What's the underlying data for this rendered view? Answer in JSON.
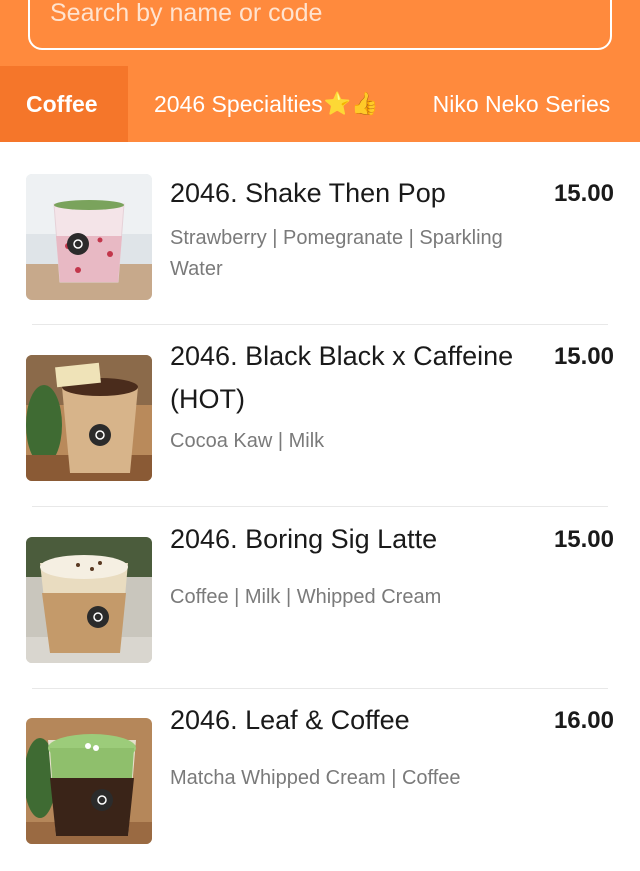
{
  "search": {
    "placeholder": "Search by name or code"
  },
  "tabs": [
    {
      "label": "Coffee",
      "active": true
    },
    {
      "label": "2046 Specialties",
      "emoji": "⭐👍",
      "active": false
    },
    {
      "label": "Niko Neko Series",
      "active": false
    }
  ],
  "products": [
    {
      "name": "2046. Shake Then Pop",
      "description": "Strawberry | Pomegranate | Sparkling Water",
      "price": "15.00",
      "image": "strawberry-drink-image"
    },
    {
      "name": "2046. Black Black x Caffeine (HOT)",
      "description": "Cocoa Kaw | Milk",
      "price": "15.00",
      "image": "cocoa-hot-cup-image"
    },
    {
      "name": "2046. Boring Sig Latte",
      "description": "Coffee | Milk | Whipped Cream",
      "price": "15.00",
      "image": "latte-cup-image"
    },
    {
      "name": "2046. Leaf & Coffee",
      "description": "Matcha Whipped Cream | Coffee",
      "price": "16.00",
      "image": "matcha-coffee-image"
    }
  ],
  "colors": {
    "header": "#ff8a3d",
    "active_tab": "#f5762a",
    "text": "#1a1a1a",
    "muted_text": "#7a7a7a"
  }
}
